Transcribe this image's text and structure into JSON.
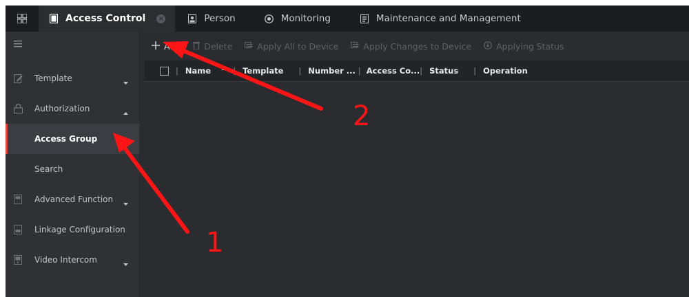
{
  "tabs": [
    {
      "label": "Access Control",
      "icon": "access-control-icon",
      "active": true
    },
    {
      "label": "Person",
      "icon": "person-icon"
    },
    {
      "label": "Monitoring",
      "icon": "monitoring-icon"
    },
    {
      "label": "Maintenance and Management",
      "icon": "maintenance-icon"
    }
  ],
  "sidebar": {
    "items": [
      {
        "label": "Template",
        "icon": "template-icon",
        "caret": "down"
      },
      {
        "label": "Authorization",
        "icon": "lock-icon",
        "caret": "up"
      },
      {
        "label": "Access Group",
        "selected": true
      },
      {
        "label": "Search"
      },
      {
        "label": "Advanced Function",
        "icon": "advanced-function-icon",
        "caret": "down"
      },
      {
        "label": "Linkage Configuration",
        "icon": "linkage-icon"
      },
      {
        "label": "Video Intercom",
        "icon": "video-intercom-icon",
        "caret": "down"
      }
    ]
  },
  "toolbar": {
    "add": "Add",
    "delete": "Delete",
    "apply_all": "Apply All to Device",
    "apply_changes": "Apply Changes to Device",
    "applying_status": "Applying Status"
  },
  "table": {
    "columns": [
      "Name",
      "Template",
      "Number ...",
      "Access Co...",
      "Status",
      "Operation"
    ]
  },
  "annotations": {
    "label_1": "1",
    "label_2": "2",
    "color": "#ff1515"
  },
  "colors": {
    "accent": "#e0403a",
    "background": "#2a2c30",
    "sidebar": "#2f3135"
  }
}
